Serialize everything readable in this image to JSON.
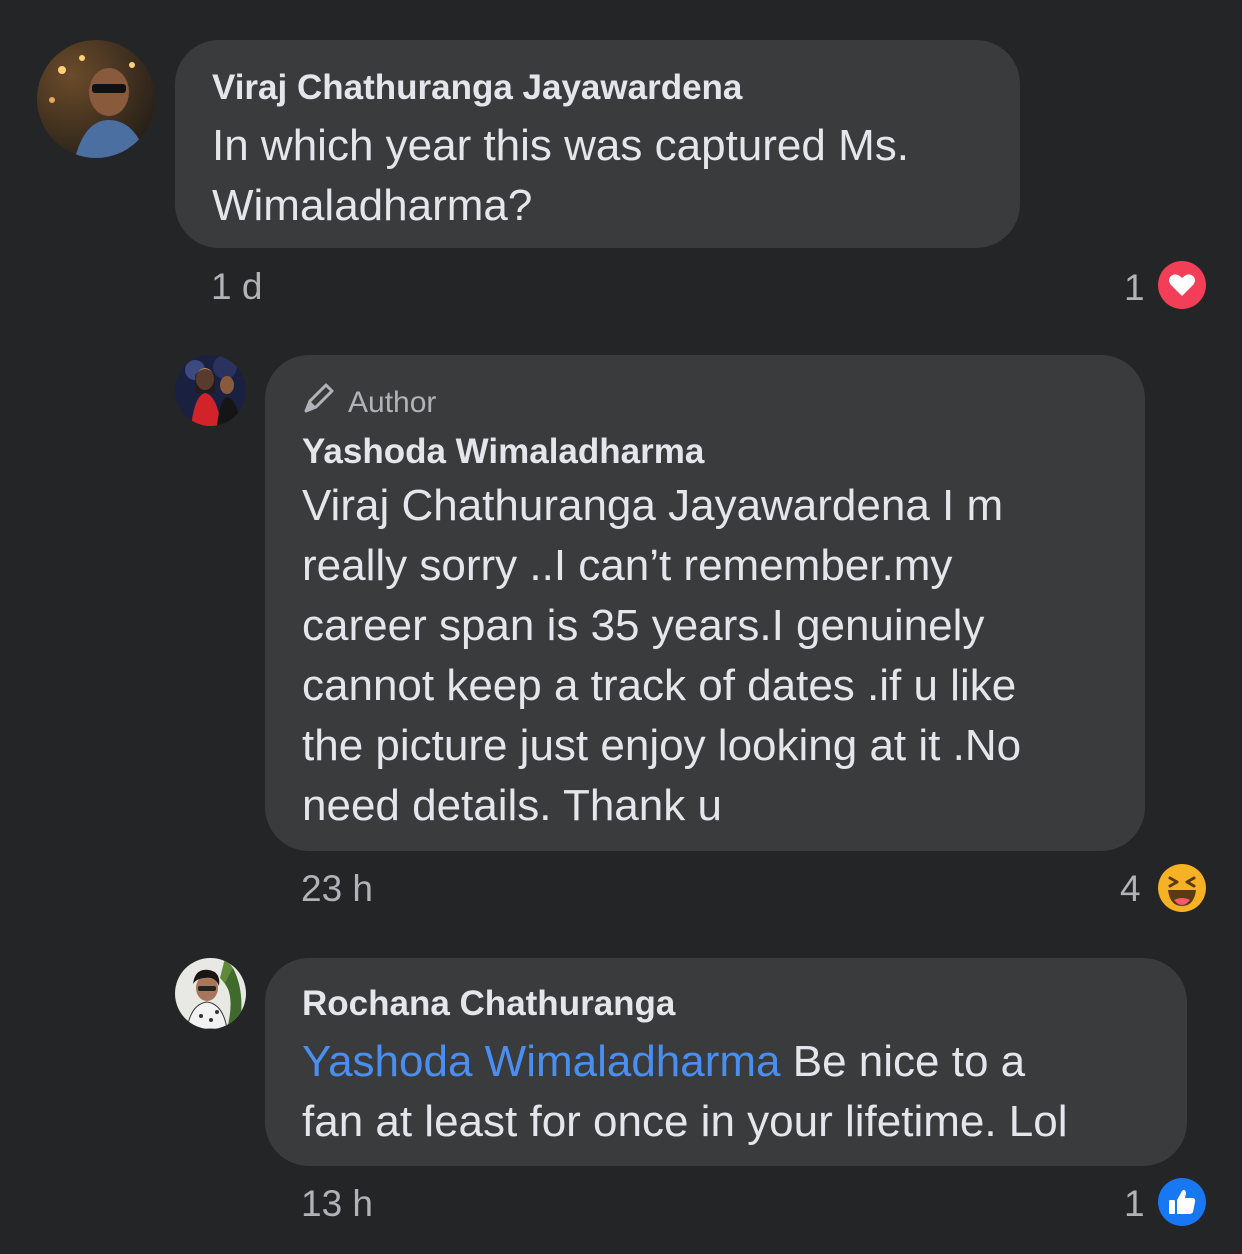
{
  "comments": [
    {
      "author": "Viraj Chathuranga Jayawardena",
      "text": "In which year this was captured Ms.\nWimaladharma?",
      "time": "1 d",
      "reaction_count": "1",
      "reaction": "love-icon",
      "avatar": "viraj-avatar"
    },
    {
      "badge": "Author",
      "author": "Yashoda Wimaladharma",
      "text": "Viraj Chathuranga Jayawardena I m\nreally sorry ..I can’t remember.my\ncareer span is 35 years.I genuinely\ncannot keep a track of dates .if u like\nthe picture just enjoy looking at it .No\nneed details. Thank u",
      "time": "23 h",
      "reaction_count": "4",
      "reaction": "haha-icon",
      "avatar": "yashoda-avatar"
    },
    {
      "author": "Rochana Chathuranga",
      "mention": "Yashoda Wimaladharma",
      "text_after_mention": " Be nice to a\nfan at least for once in your lifetime. Lol",
      "time": "13 h",
      "reaction_count": "1",
      "reaction": "like-icon",
      "avatar": "rochana-avatar"
    }
  ],
  "colors": {
    "background": "#242526",
    "bubble": "#3a3b3c",
    "mention": "#4a8ef0",
    "love": "#f33e58",
    "haha": "#f7b125",
    "like": "#1877f2"
  }
}
